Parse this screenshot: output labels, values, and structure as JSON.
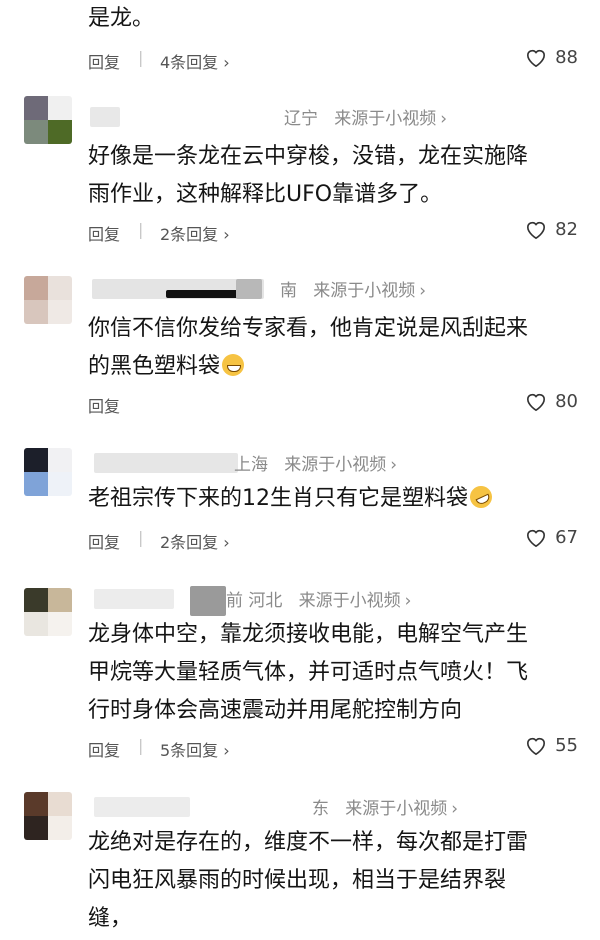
{
  "comments": [
    {
      "lines": [
        "是龙。"
      ],
      "reply_label": "回复",
      "replies_label": "4条回复",
      "chevron": "›",
      "likes": "88",
      "icons": [
        "heart-icon",
        "chevron-right-icon"
      ]
    },
    {
      "location": "辽宁",
      "source": "来源于小视频",
      "chevron": "›",
      "lines": [
        "好像是一条龙在云中穿梭，没错，龙在实施降",
        "雨作业，这种解释比UFO靠谱多了。"
      ],
      "reply_label": "回复",
      "replies_label": "2条回复",
      "likes": "82",
      "avatar_colors": [
        "#6e6a78",
        "#f0f0f0",
        "#7c8a7c",
        "#4e6a26"
      ]
    },
    {
      "location": "南",
      "source": "来源于小视频",
      "chevron": "›",
      "lines": [
        "你信不信你发给专家看，他肯定说是风刮起来",
        "的黑色塑料袋"
      ],
      "emoji": "grinning-face-emoji",
      "reply_label": "回复",
      "likes": "80",
      "avatar_colors": [
        "#c7a89a",
        "#e9e1dc",
        "#d8c6bd",
        "#efe9e5"
      ]
    },
    {
      "location": "上海",
      "source": "来源于小视频",
      "chevron": "›",
      "lines": [
        "老祖宗传下来的12生肖只有它是塑料袋"
      ],
      "emoji": "rolling-laughing-emoji",
      "reply_label": "回复",
      "replies_label": "2条回复",
      "likes": "67",
      "avatar_colors": [
        "#1c1f2a",
        "#f1f1f3",
        "#7fa3d8",
        "#eef2f8"
      ]
    },
    {
      "location": "前  河北",
      "source": "来源于小视频",
      "chevron": "›",
      "lines": [
        "龙身体中空，靠龙须接收电能，电解空气产生",
        "甲烷等大量轻质气体，并可适时点气喷火！飞",
        "行时身体会高速震动并用尾舵控制方向"
      ],
      "reply_label": "回复",
      "replies_label": "5条回复",
      "likes": "55",
      "avatar_colors": [
        "#3a3a2a",
        "#c8b79a",
        "#e9e6e0",
        "#f5f2ee"
      ]
    },
    {
      "location": "东",
      "source": "来源于小视频",
      "chevron": "›",
      "lines": [
        "龙绝对是存在的，维度不一样，每次都是打雷",
        "闪电狂风暴雨的时候出现，相当于是结界裂",
        "缝，"
      ],
      "avatar_colors": [
        "#5a3a2a",
        "#e8dcd2",
        "#2e2420",
        "#f3eee9"
      ]
    }
  ]
}
